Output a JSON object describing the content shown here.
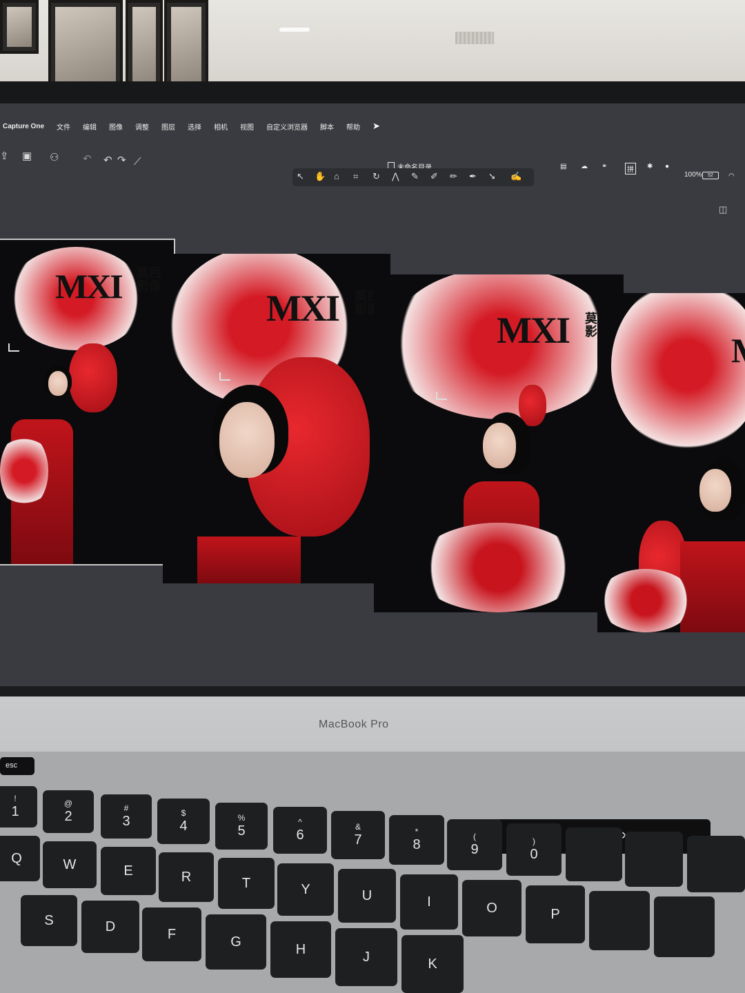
{
  "menubar": {
    "app": "Capture One",
    "items": [
      "文件",
      "编辑",
      "图像",
      "调整",
      "图层",
      "选择",
      "相机",
      "视图",
      "自定义浏览器",
      "脚本",
      "帮助"
    ]
  },
  "window": {
    "title": "未命名目录"
  },
  "status": {
    "input_method": "拼",
    "battery": "100%",
    "battery_badge": "52"
  },
  "thumbs": [
    {
      "logo": "MXI",
      "logo_cn": "莫西\n影像"
    },
    {
      "logo": "MXI",
      "logo_cn": "莫西\n影像"
    },
    {
      "logo": "MXI",
      "logo_cn": "莫西\n影像"
    },
    {
      "logo": "M",
      "logo_cn": ""
    }
  ],
  "laptop": {
    "brand": "MacBook Pro"
  },
  "keyboard": {
    "esc": "esc",
    "row_numbers": [
      {
        "top": "!",
        "bottom": "1"
      },
      {
        "top": "@",
        "bottom": "2"
      },
      {
        "top": "#",
        "bottom": "3"
      },
      {
        "top": "$",
        "bottom": "4"
      },
      {
        "top": "%",
        "bottom": "5"
      },
      {
        "top": "^",
        "bottom": "6"
      },
      {
        "top": "&",
        "bottom": "7"
      },
      {
        "top": "*",
        "bottom": "8"
      },
      {
        "top": "(",
        "bottom": "9"
      },
      {
        "top": ")",
        "bottom": "0"
      }
    ],
    "row_q": [
      "Q",
      "W",
      "E",
      "R",
      "T",
      "Y",
      "U",
      "I",
      "O",
      "P"
    ],
    "row_a": [
      "S",
      "D",
      "F",
      "G",
      "H",
      "J",
      "K"
    ]
  },
  "touchbar": {
    "icons": [
      "chevron-left-icon",
      "brightness-icon",
      "volume-icon",
      "mute-icon",
      "siri-icon"
    ]
  }
}
